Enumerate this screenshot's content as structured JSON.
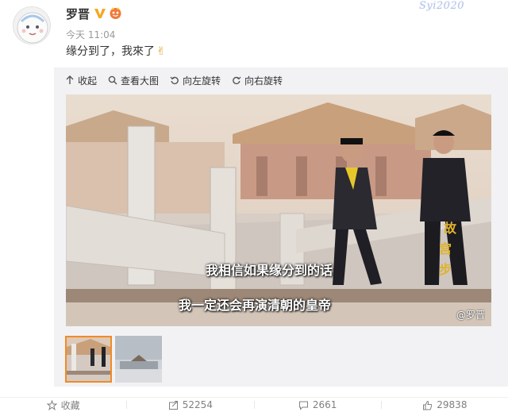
{
  "user": {
    "name": "罗晋"
  },
  "watermark": "Syi2020",
  "post": {
    "time": "今天 11:04",
    "text": "缘分到了，我來了",
    "emoji": "✌"
  },
  "toolbar": {
    "collapse": "收起",
    "view_large": "查看大图",
    "rotate_left": "向左旋转",
    "rotate_right": "向右旋转"
  },
  "image": {
    "subtitle_1": "我相信如果缘分到的话",
    "subtitle_2": "我一定还会再演清朝的皇帝",
    "overlay_watermark": "@罗晋"
  },
  "thumbnails": [
    {
      "selected": true
    },
    {
      "selected": false
    }
  ],
  "actions": {
    "favorite": "收藏",
    "repost": "52254",
    "comment": "2661",
    "like": "29838"
  },
  "colors": {
    "accent": "#f38a23",
    "verified": "#f5a623",
    "muted": "#808080"
  }
}
